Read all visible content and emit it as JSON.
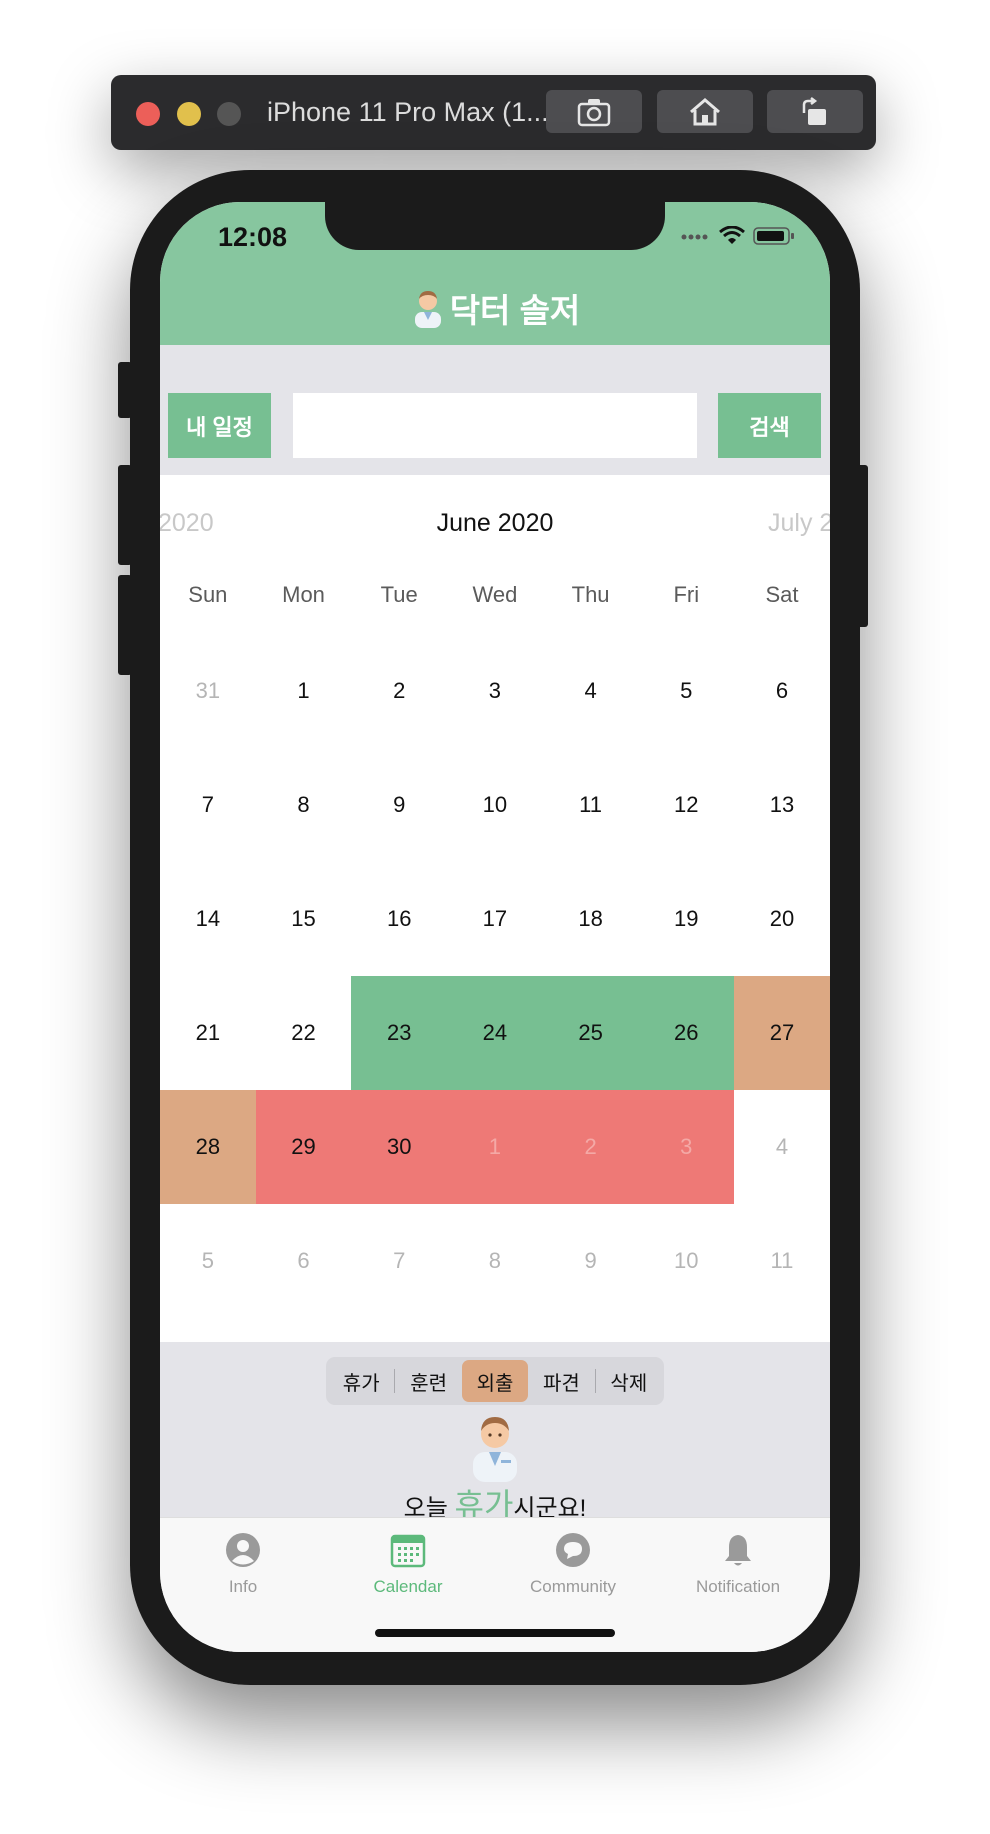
{
  "simulator": {
    "title": "iPhone 11 Pro Max (1...",
    "buttons": [
      "screenshot-icon",
      "home-icon",
      "rotate-icon"
    ]
  },
  "status_bar": {
    "time": "12:08"
  },
  "header": {
    "title": "닥터 솔저",
    "icon": "doctor-icon",
    "color": "#87c69f"
  },
  "search": {
    "my_schedule_label": "내 일정",
    "input_value": "",
    "search_label": "검색"
  },
  "calendar": {
    "prev_month": "2020",
    "current_month": "June 2020",
    "next_month": "July 2",
    "weekdays": [
      "Sun",
      "Mon",
      "Tue",
      "Wed",
      "Thu",
      "Fri",
      "Sat"
    ],
    "weeks": [
      [
        "31",
        "1",
        "2",
        "3",
        "4",
        "5",
        "6"
      ],
      [
        "7",
        "8",
        "9",
        "10",
        "11",
        "12",
        "13"
      ],
      [
        "14",
        "15",
        "16",
        "17",
        "18",
        "19",
        "20"
      ],
      [
        "21",
        "22",
        "23",
        "24",
        "25",
        "26",
        "27"
      ],
      [
        "28",
        "29",
        "30",
        "1",
        "2",
        "3",
        "4"
      ],
      [
        "5",
        "6",
        "7",
        "8",
        "9",
        "10",
        "11"
      ]
    ],
    "colors": {
      "green": "#77bf92",
      "orange": "#dca883",
      "red": "#ee7976"
    }
  },
  "segments": {
    "items": [
      "휴가",
      "훈련",
      "외출",
      "파견",
      "삭제"
    ],
    "selected": "외출"
  },
  "today": {
    "prefix": "오늘 ",
    "highlight": "휴가",
    "suffix": "시군요!"
  },
  "tabbar": {
    "items": [
      {
        "label": "Info",
        "icon": "person-icon"
      },
      {
        "label": "Calendar",
        "icon": "calendar-icon"
      },
      {
        "label": "Community",
        "icon": "chat-bubble-icon"
      },
      {
        "label": "Notification",
        "icon": "bell-icon"
      }
    ],
    "active": "Calendar"
  }
}
